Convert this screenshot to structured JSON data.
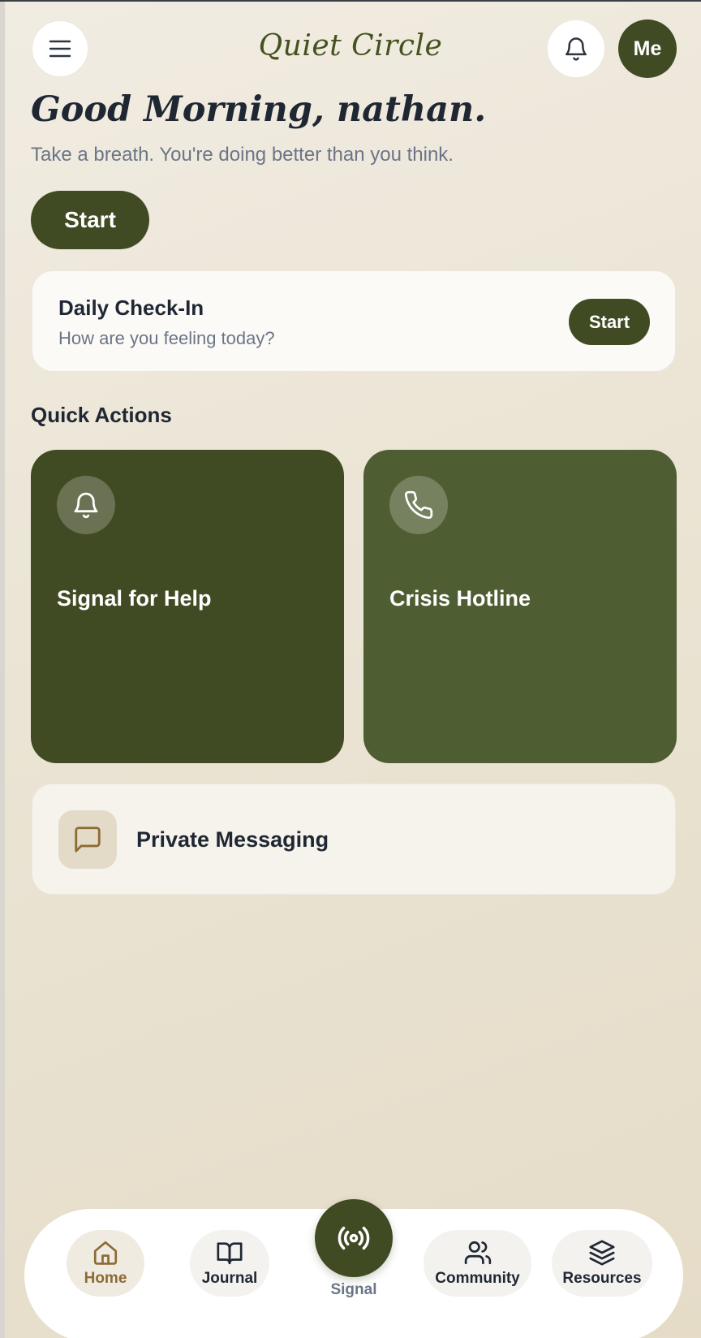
{
  "header": {
    "brand": "Quiet Circle",
    "avatar_label": "Me",
    "icons": {
      "menu": "menu-icon",
      "notifications": "bell-icon"
    }
  },
  "hero": {
    "greeting": "Good Morning, nathan.",
    "subtitle": "Take a breath. You're doing better than you think.",
    "start_label": "Start"
  },
  "checkin": {
    "title": "Daily Check-In",
    "subtitle": "How are you feeling today?",
    "start_label": "Start"
  },
  "quick_actions": {
    "heading": "Quick Actions",
    "cards": [
      {
        "label": "Signal for Help",
        "icon": "bell-icon",
        "color": "#404b23"
      },
      {
        "label": "Crisis Hotline",
        "icon": "phone-icon",
        "color": "#4f5e32"
      }
    ],
    "messaging": {
      "label": "Private Messaging",
      "icon": "chat-icon"
    }
  },
  "bottom_nav": {
    "items": [
      {
        "label": "Home",
        "icon": "home-icon",
        "active": true
      },
      {
        "label": "Journal",
        "icon": "book-icon"
      },
      {
        "label": "Signal",
        "icon": "broadcast-icon"
      },
      {
        "label": "Community",
        "icon": "users-icon"
      },
      {
        "label": "Resources",
        "icon": "layers-icon"
      }
    ]
  },
  "colors": {
    "primary": "#404b23",
    "secondary": "#4f5e32",
    "accent": "#8c6b34",
    "background": "#ece5d6"
  }
}
